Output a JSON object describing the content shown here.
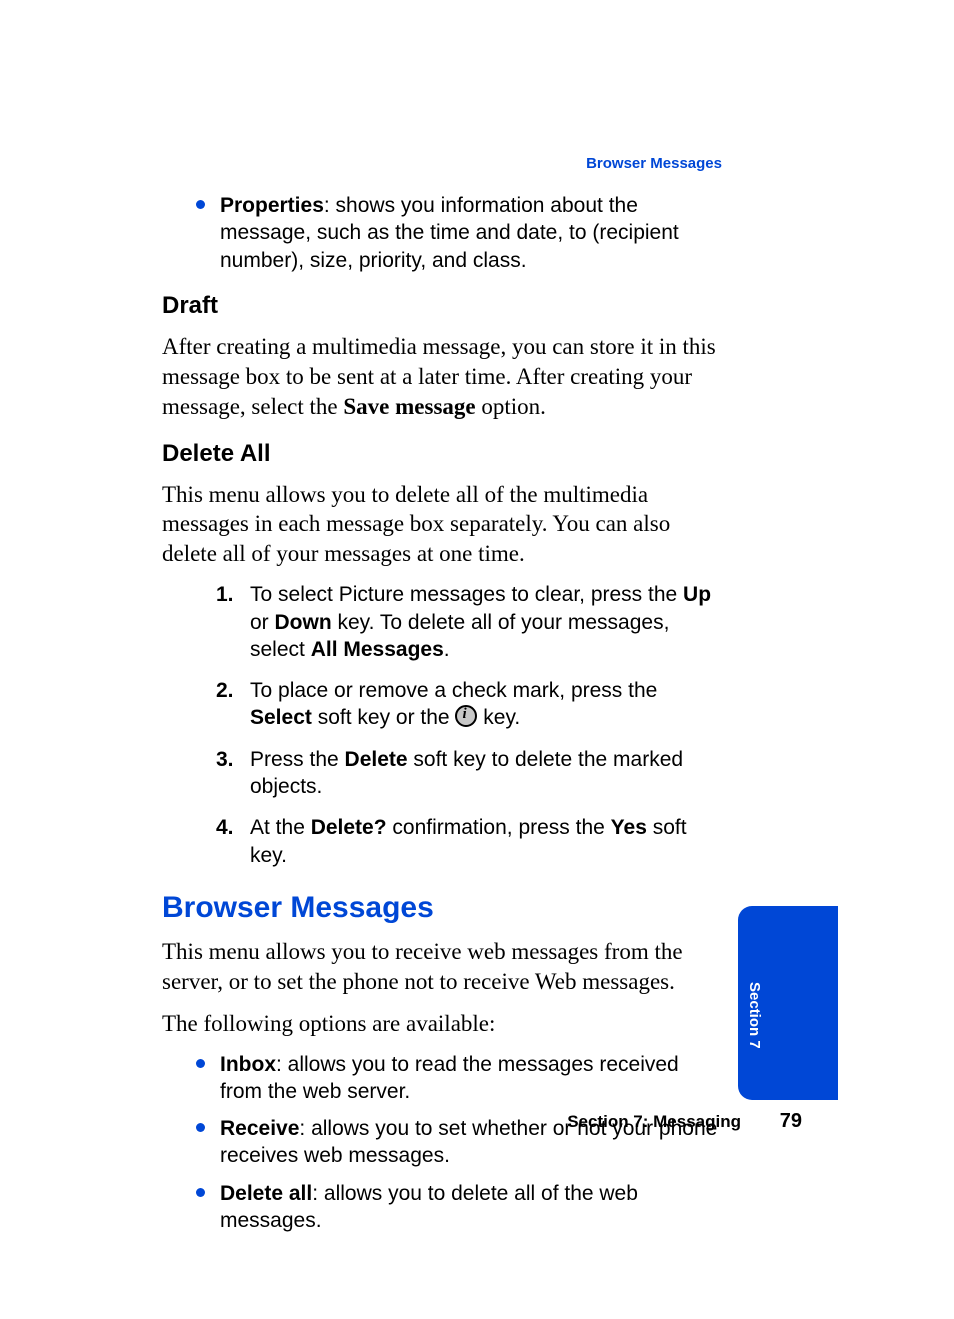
{
  "header": {
    "running_head": "Browser Messages"
  },
  "properties_bullet": {
    "term": "Properties",
    "desc": ": shows you information about the message, such as the time and date, to (recipient number), size, priority, and class."
  },
  "draft": {
    "heading": "Draft",
    "para_pre": "After creating a multimedia message, you can store it in this message box to be sent at a later time. After creating your message, select the ",
    "bold": "Save message",
    "para_post": " option."
  },
  "delete_all": {
    "heading": "Delete All",
    "intro": "This menu allows you to delete all of the multimedia messages in each message box separately. You can also delete all of your messages at one time.",
    "steps": [
      {
        "num": "1.",
        "seg1": "To select Picture messages to clear, press the ",
        "b1": "Up",
        "seg2": " or ",
        "b2": "Down",
        "seg3": " key. To delete all of your messages, select ",
        "b3": "All Messages",
        "seg4": "."
      },
      {
        "num": "2.",
        "seg1": "To place or remove a check mark, press the ",
        "b1": "Select",
        "seg2": " soft key or the ",
        "icon": "ok-key-icon",
        "seg3": " key."
      },
      {
        "num": "3.",
        "seg1": "Press the ",
        "b1": "Delete",
        "seg2": " soft key to delete the marked objects."
      },
      {
        "num": "4.",
        "seg1": "At the ",
        "b1": "Delete?",
        "seg2": " confirmation, press the ",
        "b2": "Yes",
        "seg3": " soft key."
      }
    ]
  },
  "browser": {
    "heading": "Browser Messages",
    "para1": "This menu allows you to receive web messages from the server, or to set the phone not to receive Web messages.",
    "para2": "The following options are available:",
    "bullets": [
      {
        "term": "Inbox",
        "desc": ": allows you to read the messages received from the web server."
      },
      {
        "term": "Receive",
        "desc": ": allows you to set whether or not your phone receives web messages."
      },
      {
        "term": "Delete all",
        "desc": ": allows you to delete all of the web messages."
      }
    ]
  },
  "footer": {
    "section_label": "Section 7: Messaging",
    "page_number": "79"
  },
  "side_tab": {
    "label": "Section 7"
  }
}
